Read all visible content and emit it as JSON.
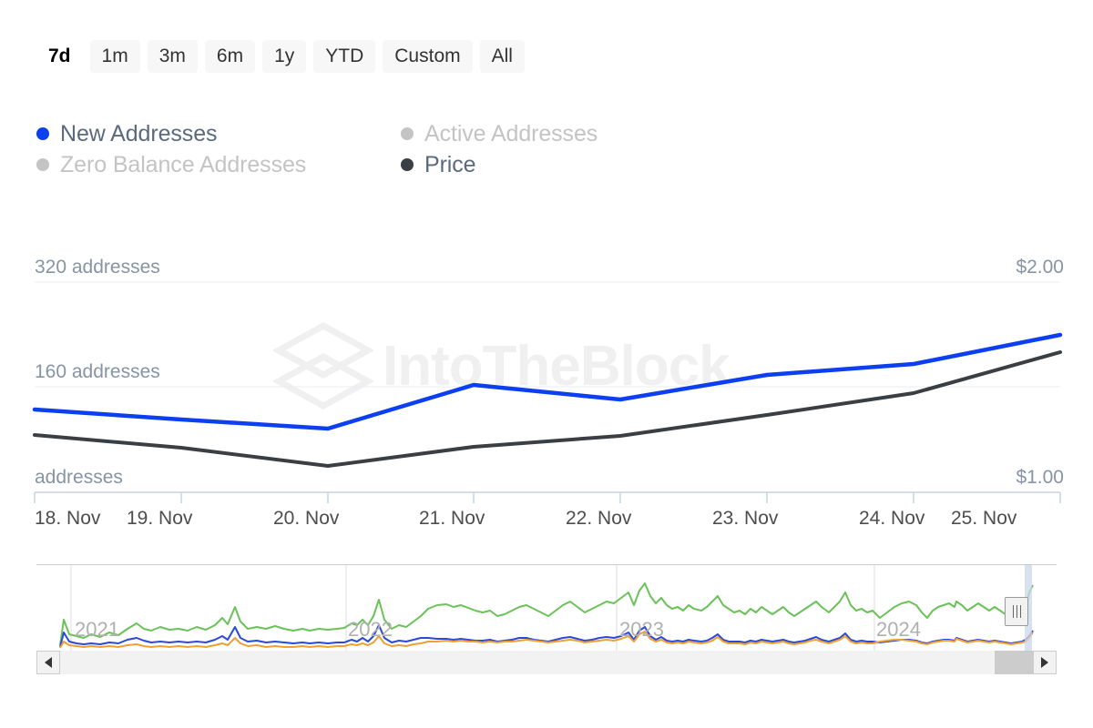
{
  "range_selector": {
    "buttons": [
      {
        "label": "7d",
        "selected": true
      },
      {
        "label": "1m",
        "selected": false
      },
      {
        "label": "3m",
        "selected": false
      },
      {
        "label": "6m",
        "selected": false
      },
      {
        "label": "1y",
        "selected": false
      },
      {
        "label": "YTD",
        "selected": false
      },
      {
        "label": "Custom",
        "selected": false
      },
      {
        "label": "All",
        "selected": false
      }
    ]
  },
  "legend": {
    "items": [
      {
        "label": "New Addresses",
        "color": "#0b3ff0",
        "active": true
      },
      {
        "label": "Active Addresses",
        "color": "#c4c4c4",
        "active": false
      },
      {
        "label": "Zero Balance Addresses",
        "color": "#c4c4c4",
        "active": false
      },
      {
        "label": "Price",
        "color": "#3a3f44",
        "active": true
      }
    ]
  },
  "watermark": {
    "text": "IntoTheBlock",
    "logo_icon": "hexagon-cube-icon"
  },
  "navigator": {
    "years": [
      "2021",
      "2022",
      "2023",
      "2024"
    ],
    "left_arrow_icon": "arrow-left-icon",
    "right_arrow_icon": "arrow-right-icon",
    "handle_icon": "drag-handle-icon",
    "series": [
      {
        "name": "zero-balance-addresses",
        "color": "#6ac259"
      },
      {
        "name": "new-addresses",
        "color": "#2b49d8"
      },
      {
        "name": "active-addresses",
        "color": "#f0a030"
      }
    ]
  },
  "chart_data": {
    "type": "line",
    "title": "",
    "xlabel": "",
    "categories": [
      "18. Nov",
      "19. Nov",
      "20. Nov",
      "21. Nov",
      "22. Nov",
      "23. Nov",
      "24. Nov",
      "25. Nov"
    ],
    "left_axis": {
      "label": "addresses",
      "ticks": [
        {
          "value": 320,
          "label": "320 addresses"
        },
        {
          "value": 160,
          "label": "160 addresses"
        },
        {
          "value": 0,
          "label": "addresses"
        }
      ],
      "ylim": [
        0,
        320
      ],
      "unit": "addresses"
    },
    "right_axis": {
      "label": "Price",
      "ticks": [
        {
          "value": 2.0,
          "label": "$2.00"
        },
        {
          "value": 1.0,
          "label": "$1.00"
        }
      ],
      "ylim": [
        0.5,
        2.0
      ],
      "unit": "USD"
    },
    "grid": true,
    "legend_position": "top-left",
    "series": [
      {
        "name": "New Addresses",
        "color": "#0b3ff0",
        "axis": "left",
        "values": [
          127,
          119,
          100,
          165,
          143,
          180,
          192,
          229
        ]
      },
      {
        "name": "Price",
        "color": "#3a3f44",
        "axis": "right",
        "values": [
          1.18,
          1.12,
          1.03,
          1.12,
          1.18,
          1.3,
          1.42,
          1.68
        ]
      }
    ]
  }
}
